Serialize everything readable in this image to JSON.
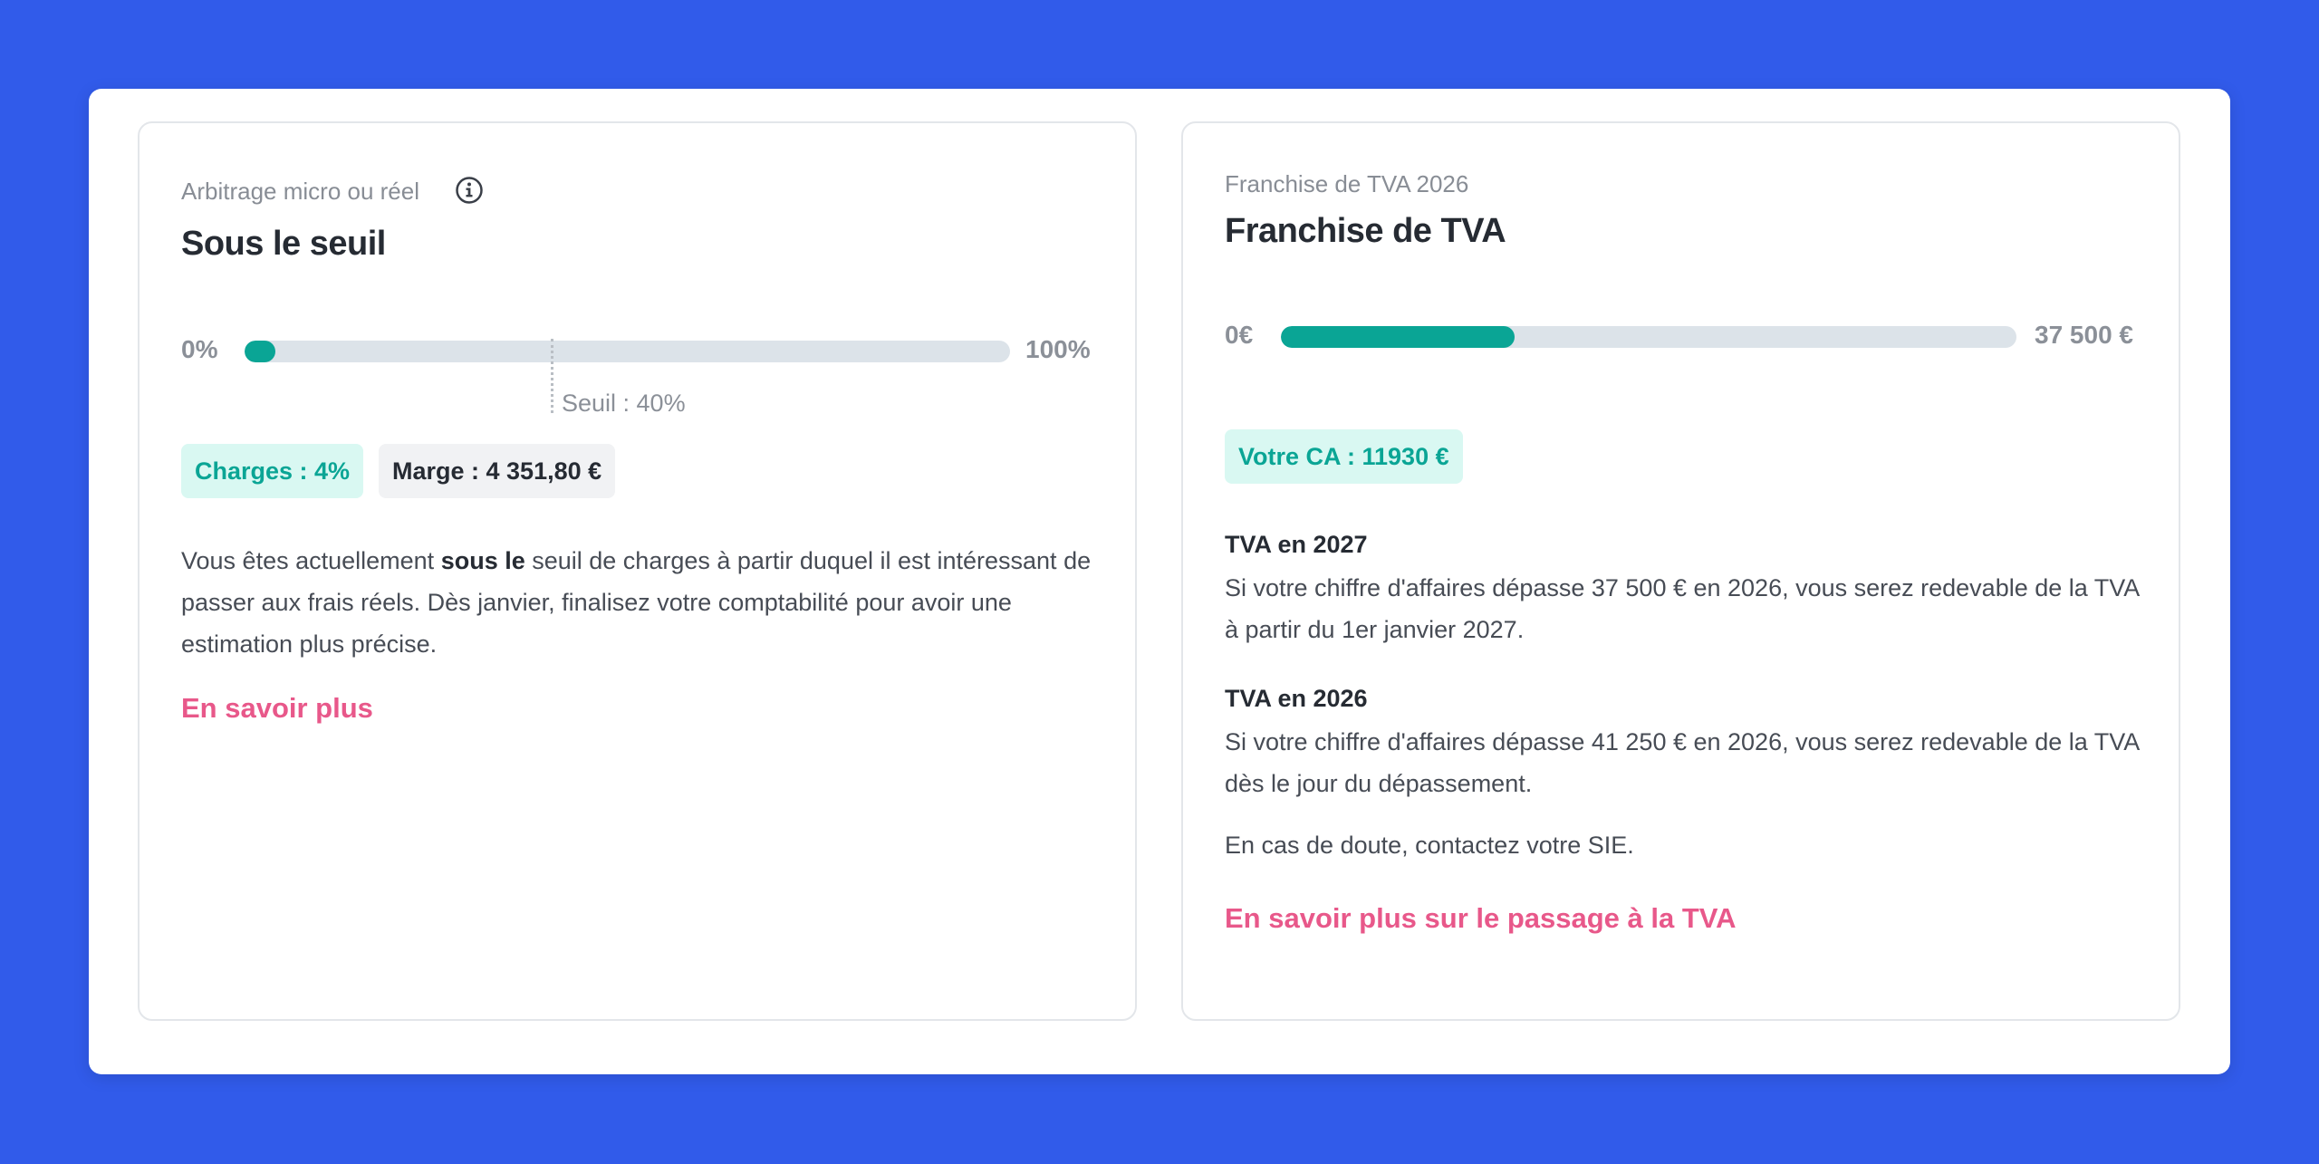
{
  "left_card": {
    "subtitle": "Arbitrage micro ou réel",
    "title": "Sous le seuil",
    "bar_min_label": "0%",
    "bar_max_label": "100%",
    "progress_percent": 4,
    "threshold_percent": 40,
    "threshold_label": "Seuil : 40%",
    "chip_charges": "Charges : 4%",
    "chip_marge": "Marge : 4 351,80 €",
    "paragraph_before": "Vous êtes actuellement ",
    "paragraph_bold": "sous le",
    "paragraph_after": " seuil de charges à partir duquel il est intéressant de passer aux frais réels. Dès janvier, finalisez votre comptabilité pour avoir une estimation plus précise.",
    "link": "En savoir plus"
  },
  "right_card": {
    "subtitle": "Franchise de TVA 2026",
    "title": "Franchise de TVA",
    "bar_min_label": "0€",
    "bar_max_label": "37 500 €",
    "bar_max_value": 37500,
    "ca_value": 11930,
    "chip_ca": "Votre CA : 11930 €",
    "section1_heading": "TVA en 2027",
    "section1_text": "Si votre chiffre d'affaires dépasse 37 500 € en 2026, vous serez redevable de la TVA à partir du 1er janvier 2027.",
    "section2_heading": "TVA en 2026",
    "section2_text": "Si votre chiffre d'affaires dépasse 41 250 € en 2026, vous serez redevable de la TVA dès le jour du dépassement.",
    "note": "En cas de doute, contactez votre SIE.",
    "link": "En savoir plus sur le passage à la TVA"
  },
  "colors": {
    "background": "#315bea",
    "accent_teal": "#0aa595",
    "link_pink": "#e8588a",
    "track": "#dce3e9"
  },
  "icons": {
    "info": "info-circle-icon"
  }
}
